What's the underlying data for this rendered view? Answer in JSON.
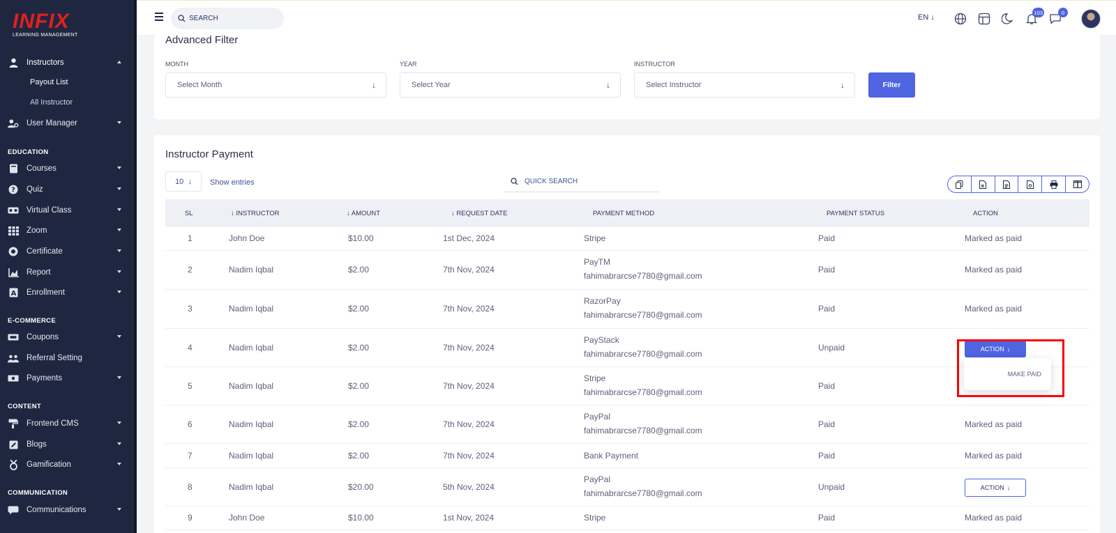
{
  "brand": {
    "logo": "INFIX",
    "subtitle": "LEARNING MANAGEMENT"
  },
  "sidebar": {
    "instructors": "Instructors",
    "payout_list": "Payout List",
    "all_instructor": "All Instructor",
    "user_manager": "User Manager",
    "sections": {
      "education": "EDUCATION",
      "ecommerce": "E-COMMERCE",
      "content": "CONTENT",
      "communication": "COMMUNICATION"
    },
    "items": {
      "courses": "Courses",
      "quiz": "Quiz",
      "virtual_class": "Virtual Class",
      "zoom": "Zoom",
      "certificate": "Certificate",
      "report": "Report",
      "enrollment": "Enrollment",
      "coupons": "Coupons",
      "referral": "Referral Setting",
      "payments": "Payments",
      "frontend_cms": "Frontend CMS",
      "blogs": "Blogs",
      "gamification": "Gamification",
      "communications": "Communications"
    }
  },
  "topbar": {
    "search_placeholder": "SEARCH",
    "language": "EN",
    "notifications_count": "103",
    "messages_count": "0"
  },
  "filter": {
    "title": "Advanced Filter",
    "month_label": "MONTH",
    "month_value": "Select Month",
    "year_label": "YEAR",
    "year_value": "Select Year",
    "instructor_label": "INSTRUCTOR",
    "instructor_value": "Select Instructor",
    "button": "Filter"
  },
  "payments": {
    "title": "Instructor Payment",
    "page_size": "10",
    "show_entries": "Show entries",
    "quick_search_placeholder": "QUICK SEARCH",
    "columns": {
      "sl": "SL",
      "instructor": "INSTRUCTOR",
      "amount": "AMOUNT",
      "request_date": "REQUEST DATE",
      "payment_method": "PAYMENT METHOD",
      "payment_status": "PAYMENT STATUS",
      "action": "ACTION"
    },
    "rows": [
      {
        "sl": "1",
        "instructor": "John Doe",
        "amount": "$10.00",
        "date": "1st Dec, 2024",
        "method": "Stripe",
        "email": "",
        "status": "Paid",
        "action": "Marked as paid"
      },
      {
        "sl": "2",
        "instructor": "Nadim Iqbal",
        "amount": "$2.00",
        "date": "7th Nov, 2024",
        "method": "PayTM",
        "email": "fahimabrarcse7780@gmail.com",
        "status": "Paid",
        "action": "Marked as paid"
      },
      {
        "sl": "3",
        "instructor": "Nadim Iqbal",
        "amount": "$2.00",
        "date": "7th Nov, 2024",
        "method": "RazorPay",
        "email": "fahimabrarcse7780@gmail.com",
        "status": "Paid",
        "action": "Marked as paid"
      },
      {
        "sl": "4",
        "instructor": "Nadim Iqbal",
        "amount": "$2.00",
        "date": "7th Nov, 2024",
        "method": "PayStack",
        "email": "fahimabrarcse7780@gmail.com",
        "status": "Unpaid",
        "action": "ACTION"
      },
      {
        "sl": "5",
        "instructor": "Nadim Iqbal",
        "amount": "$2.00",
        "date": "7th Nov, 2024",
        "method": "Stripe",
        "email": "fahimabrarcse7780@gmail.com",
        "status": "Paid",
        "action": ""
      },
      {
        "sl": "6",
        "instructor": "Nadim Iqbal",
        "amount": "$2.00",
        "date": "7th Nov, 2024",
        "method": "PayPal",
        "email": "fahimabrarcse7780@gmail.com",
        "status": "Paid",
        "action": "Marked as paid"
      },
      {
        "sl": "7",
        "instructor": "Nadim Iqbal",
        "amount": "$2.00",
        "date": "7th Nov, 2024",
        "method": "Bank Payment",
        "email": "",
        "status": "Paid",
        "action": "Marked as paid"
      },
      {
        "sl": "8",
        "instructor": "Nadim Iqbal",
        "amount": "$20.00",
        "date": "5th Nov, 2024",
        "method": "PayPal",
        "email": "fahimabrarcse7780@gmail.com",
        "status": "Unpaid",
        "action": "ACTION"
      },
      {
        "sl": "9",
        "instructor": "John Doe",
        "amount": "$10.00",
        "date": "1st Nov, 2024",
        "method": "Stripe",
        "email": "",
        "status": "Paid",
        "action": "Marked as paid"
      }
    ],
    "dropdown_item": "MAKE PAID"
  },
  "colors": {
    "sidebar_bg": "#1f2740",
    "accent": "#4e64e0",
    "logo_red": "#e02020",
    "highlight": "#ff0000"
  }
}
